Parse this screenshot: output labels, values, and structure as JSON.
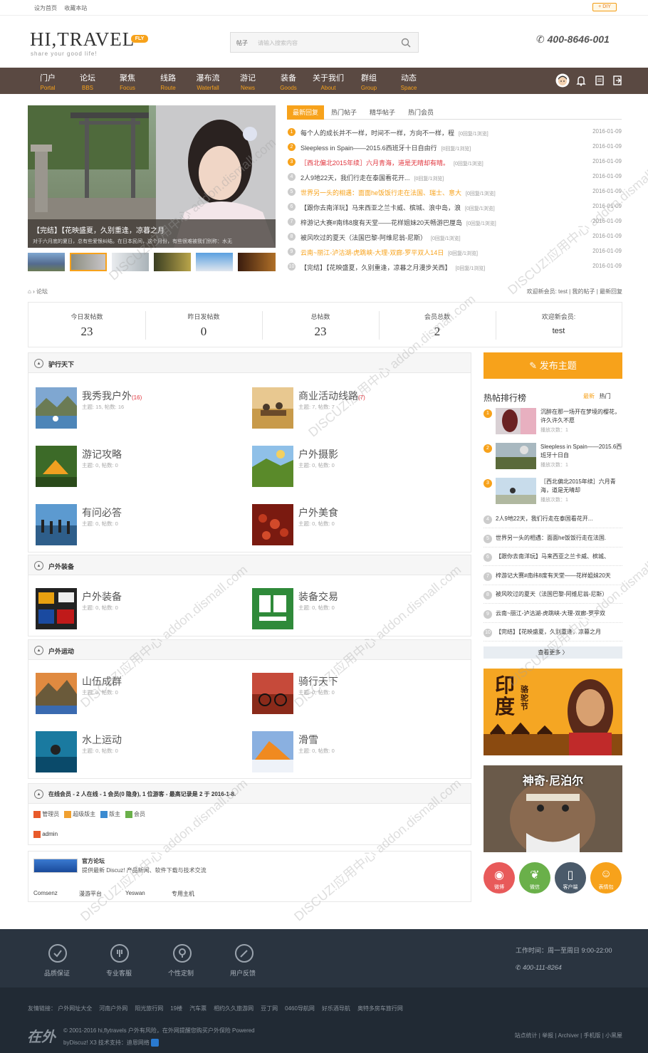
{
  "topbar": {
    "set_home": "设为首页",
    "bookmark": "收藏本站",
    "diy": "DIY"
  },
  "header": {
    "logo": "HI,TRAVEL",
    "logo_badge": "FLY",
    "slogan": "share your good life!",
    "search_type": "帖子",
    "search_placeholder": "请输入搜索内容",
    "phone": "400-8646-001"
  },
  "nav": [
    {
      "cn": "门户",
      "en": "Portal"
    },
    {
      "cn": "论坛",
      "en": "BBS"
    },
    {
      "cn": "聚焦",
      "en": "Focus"
    },
    {
      "cn": "线路",
      "en": "Route"
    },
    {
      "cn": "瀑布流",
      "en": "Waterfall"
    },
    {
      "cn": "游记",
      "en": "News"
    },
    {
      "cn": "装备",
      "en": "Goods"
    },
    {
      "cn": "关于我们",
      "en": "About"
    },
    {
      "cn": "群组",
      "en": "Group"
    },
    {
      "cn": "动态",
      "en": "Space"
    }
  ],
  "slider": {
    "title": "【完结】【花映盛夏，久别重逢，凉暮之月",
    "desc": "对于六月底的夏日，总有些爱恨纠结。在日本民间，这个月份，有些很难被我们别称：水无"
  },
  "tabs": [
    "最新回复",
    "热门帖子",
    "精华帖子",
    "热门会员"
  ],
  "latest": [
    {
      "n": "1",
      "title": "每个人的成长并不一样，时间不一样，方向不一样，程",
      "stat": "[0回复/1浏览]",
      "date": "2016-01-09",
      "color": ""
    },
    {
      "n": "2",
      "title": "Sleepless in Spain——2015.6西班牙十日自由行",
      "stat": "[0回复/1浏览]",
      "date": "2016-01-09",
      "color": ""
    },
    {
      "n": "3",
      "title": "［西北偏北2015年续］六月青海，道是无晴却有晴。",
      "stat": "[0回复/1浏览]",
      "date": "2016-01-09",
      "color": "red"
    },
    {
      "n": "4",
      "title": "2人9地22天，我们行走在泰国看花开...",
      "stat": "[0回复/1浏览]",
      "date": "2016-01-09",
      "color": ""
    },
    {
      "n": "5",
      "title": "世界另一头的相遇：面面he饭饭行走在法国、瑞士、意大",
      "stat": "[0回复/1浏览]",
      "date": "2016-01-09",
      "color": "orange"
    },
    {
      "n": "6",
      "title": "【跟你去南洋玩】马来西亚之兰卡威、槟城、浪中岛，浪",
      "stat": "[0回复/1浏览]",
      "date": "2016-01-09",
      "color": ""
    },
    {
      "n": "7",
      "title": "梓游记大赛#南纬8度有天堂——花样姐妹20天畅游巴厘岛",
      "stat": "[0回复/1浏览]",
      "date": "2016-01-09",
      "color": ""
    },
    {
      "n": "8",
      "title": "被风吹过的夏天（法国巴黎-阿维尼翁-尼斯）",
      "stat": "[0回复/1浏览]",
      "date": "2016-01-09",
      "color": ""
    },
    {
      "n": "9",
      "title": "云南~丽江-泸沽湖-虎跳峡-大理-双廊-罗平双人14日",
      "stat": "[0回复/1浏览]",
      "date": "2016-01-09",
      "color": "orange"
    },
    {
      "n": "10",
      "title": "【完结】【花映盛夏，久别重逢，凉暮之月漫步关西】",
      "stat": "[0回复/1浏览]",
      "date": "2016-01-09",
      "color": ""
    }
  ],
  "breadcrumb": {
    "current": "论坛",
    "right": "欢迎新会员: test  |  我的帖子  |  最新回复"
  },
  "stats": [
    {
      "label": "今日发帖数",
      "value": "23"
    },
    {
      "label": "昨日发帖数",
      "value": "0"
    },
    {
      "label": "总帖数",
      "value": "23"
    },
    {
      "label": "会员总数",
      "value": "2"
    },
    {
      "label": "欢迎新会员:",
      "value": "test"
    }
  ],
  "blocks": [
    {
      "title": "驴行天下",
      "forums": [
        {
          "name": "我秀我户外",
          "count": "(16)",
          "meta": "主题: 15, 帖数: 16"
        },
        {
          "name": "商业活动线路",
          "count": "(7)",
          "meta": "主题: 7, 帖数: 7"
        },
        {
          "name": "游记攻略",
          "count": "",
          "meta": "主题: 0, 帖数: 0"
        },
        {
          "name": "户外摄影",
          "count": "",
          "meta": "主题: 0, 帖数: 0"
        },
        {
          "name": "有问必答",
          "count": "",
          "meta": "主题: 0, 帖数: 0"
        },
        {
          "name": "户外美食",
          "count": "",
          "meta": "主题: 0, 帖数: 0"
        }
      ]
    },
    {
      "title": "户外装备",
      "forums": [
        {
          "name": "户外装备",
          "count": "",
          "meta": "主题: 0, 帖数: 0"
        },
        {
          "name": "装备交易",
          "count": "",
          "meta": "主题: 0, 帖数: 0"
        }
      ]
    },
    {
      "title": "户外运动",
      "forums": [
        {
          "name": "山伍成群",
          "count": "",
          "meta": "主题: 0, 帖数: 0"
        },
        {
          "name": "骑行天下",
          "count": "",
          "meta": "主题: 0, 帖数: 0"
        },
        {
          "name": "水上运动",
          "count": "",
          "meta": "主题: 0, 帖数: 0"
        },
        {
          "name": "滑雪",
          "count": "",
          "meta": "主题: 0, 帖数: 0"
        }
      ]
    }
  ],
  "online": {
    "title": "在线会员 - 2 人在线 - 1 会员(0 隐身), 1 位游客 - 最高记录是 2 于 2016-1-8.",
    "legend": [
      "管理员",
      "超级版主",
      "版主",
      "会员"
    ],
    "user": "admin"
  },
  "friendlinks": {
    "title": "官方论坛",
    "desc": "提供最新 Discuz! 产品新闻、软件下载与技术交流",
    "items": [
      "Comsenz",
      "漫游平台",
      "Yeswan",
      "专用主机"
    ]
  },
  "sidebar": {
    "post_button": "发布主题",
    "hot_title": "热帖排行榜",
    "hot_tabs": [
      "最新",
      "热门"
    ],
    "ranked": [
      {
        "n": "1",
        "title": "沉醉在那一场开在梦境的樱花，许久许久不愿",
        "count": "播放次数：1"
      },
      {
        "n": "2",
        "title": "Sleepless in Spain——2015.6西班牙十日自",
        "count": "播放次数：1"
      },
      {
        "n": "3",
        "title": "［西北偏北2015年续］六月青海，道是无晴却",
        "count": "播放次数：1"
      }
    ],
    "list": [
      {
        "n": "4",
        "title": "2人9地22天，我们行走在泰国看花开..."
      },
      {
        "n": "5",
        "title": "世界另一头的相遇：面面he饭饭行走在法国."
      },
      {
        "n": "6",
        "title": "【跟你去南洋玩】马来西亚之兰卡威、槟城、"
      },
      {
        "n": "7",
        "title": "梓游记大赛#南纬8度有天堂——花样姐妹20天"
      },
      {
        "n": "8",
        "title": "被风吹过的夏天（法国巴黎-阿维尼翁-尼斯）"
      },
      {
        "n": "9",
        "title": "云南~丽江-泸沽湖-虎跳峡-大理-双廊-罗平双"
      },
      {
        "n": "10",
        "title": "【完结】【花映盛夏，久别重逢，凉暮之月"
      }
    ],
    "more": "查看更多 〉",
    "ad1": {
      "big": "印度",
      "small": "骆驼节"
    },
    "ad2": {
      "title": "神奇·尼泊尔"
    },
    "social": [
      "微博",
      "微信",
      "客户端",
      "表情包"
    ]
  },
  "footer": {
    "features": [
      "品质保证",
      "专业客服",
      "个性定制",
      "用户反馈"
    ],
    "worktime": "工作时间：周一至周日 9:00-22:00",
    "phone": "400-111-8264",
    "links_label": "友情链接：",
    "links": [
      "户外网址大全",
      "河南户外网",
      "阳光旅行网",
      "19楼",
      "汽车票",
      "相约久久旅游网",
      "豆丁网",
      "0460导航网",
      "好乐酒导航",
      "奥特多房车旅行网"
    ],
    "copyright": "© 2001-2016 hi,flytravels 户外有风险，在外网提醒您购买户外保险 Powered",
    "powered": "byDiscuz! X3  技术支持：迪恩网络",
    "right_links": "站点统计 | 举报 | Archiver | 手机版 | 小黑屋",
    "brand": "在外"
  },
  "watermark": "DISCUZ!应用中心 addon.dismall.com"
}
